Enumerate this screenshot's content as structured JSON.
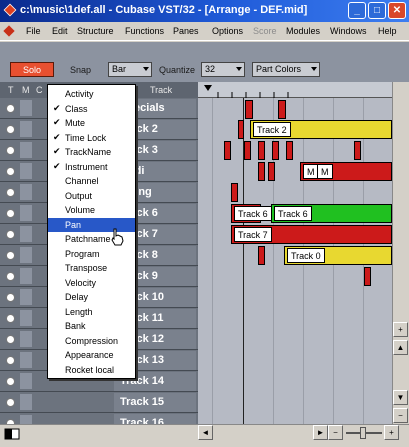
{
  "window": {
    "title": "c:\\music\\1def.all - Cubase VST/32 - [Arrange - DEF.mid]",
    "min_label": "_",
    "max_label": "□",
    "close_label": "✕"
  },
  "menubar": {
    "items": [
      {
        "label": "File",
        "enabled": true
      },
      {
        "label": "Edit",
        "enabled": true
      },
      {
        "label": "Structure",
        "enabled": true
      },
      {
        "label": "Functions",
        "enabled": true
      },
      {
        "label": "Panes",
        "enabled": true
      },
      {
        "label": "Options",
        "enabled": true
      },
      {
        "label": "Score",
        "enabled": false
      },
      {
        "label": "Modules",
        "enabled": true
      },
      {
        "label": "Windows",
        "enabled": true
      },
      {
        "label": "Help",
        "enabled": true
      }
    ]
  },
  "toolbar": {
    "solo_label": "Solo",
    "snap_label": "Snap",
    "snap_value": "Bar",
    "quantize_label": "Quantize",
    "quantize_value": "32",
    "color_value": "Part Colors"
  },
  "track_header": {
    "t": "T",
    "m": "M",
    "c": "C",
    "track": "Track"
  },
  "tracks": [
    {
      "name": "Specials"
    },
    {
      "name": "Track 2"
    },
    {
      "name": "Track 3"
    },
    {
      "name": "Audi"
    },
    {
      "name": "String"
    },
    {
      "name": "Track 6"
    },
    {
      "name": "Track 7"
    },
    {
      "name": "Track 8"
    },
    {
      "name": "Track 9"
    },
    {
      "name": "Track 10"
    },
    {
      "name": "Track 11"
    },
    {
      "name": "Track 12"
    },
    {
      "name": "Track 13"
    },
    {
      "name": "Track 14"
    },
    {
      "name": "Track 15"
    },
    {
      "name": "Track 16"
    }
  ],
  "context_menu": {
    "items": [
      {
        "label": "Activity",
        "checked": false
      },
      {
        "label": "Class",
        "checked": true
      },
      {
        "label": "Mute",
        "checked": true
      },
      {
        "label": "Time Lock",
        "checked": true
      },
      {
        "label": "TrackName",
        "checked": true
      },
      {
        "label": "Instrument",
        "checked": true
      },
      {
        "label": "Channel",
        "checked": false
      },
      {
        "label": "Output",
        "checked": false
      },
      {
        "label": "Volume",
        "checked": false
      },
      {
        "label": "Pan",
        "checked": false,
        "highlighted": true
      },
      {
        "label": "Patchname",
        "checked": false
      },
      {
        "label": "Program",
        "checked": false
      },
      {
        "label": "Transpose",
        "checked": false
      },
      {
        "label": "Velocity",
        "checked": false
      },
      {
        "label": "Delay",
        "checked": false
      },
      {
        "label": "Length",
        "checked": false
      },
      {
        "label": "Bank",
        "checked": false
      },
      {
        "label": "Compression",
        "checked": false
      },
      {
        "label": "Appearance",
        "checked": false
      },
      {
        "label": "Rocket local",
        "checked": false
      }
    ]
  },
  "parts": {
    "track2_label": "Track 2",
    "m_label": "M",
    "m2_label": "M",
    "track6_label": "Track 6",
    "track6b_label": "Track 6",
    "track7_label": "Track 7",
    "track0_label": "Track 0"
  },
  "colors": {
    "red_part": "#cc1a1a",
    "yellow_part": "#e8d830",
    "green_part": "#20c020",
    "highlight": "#2858c8"
  }
}
